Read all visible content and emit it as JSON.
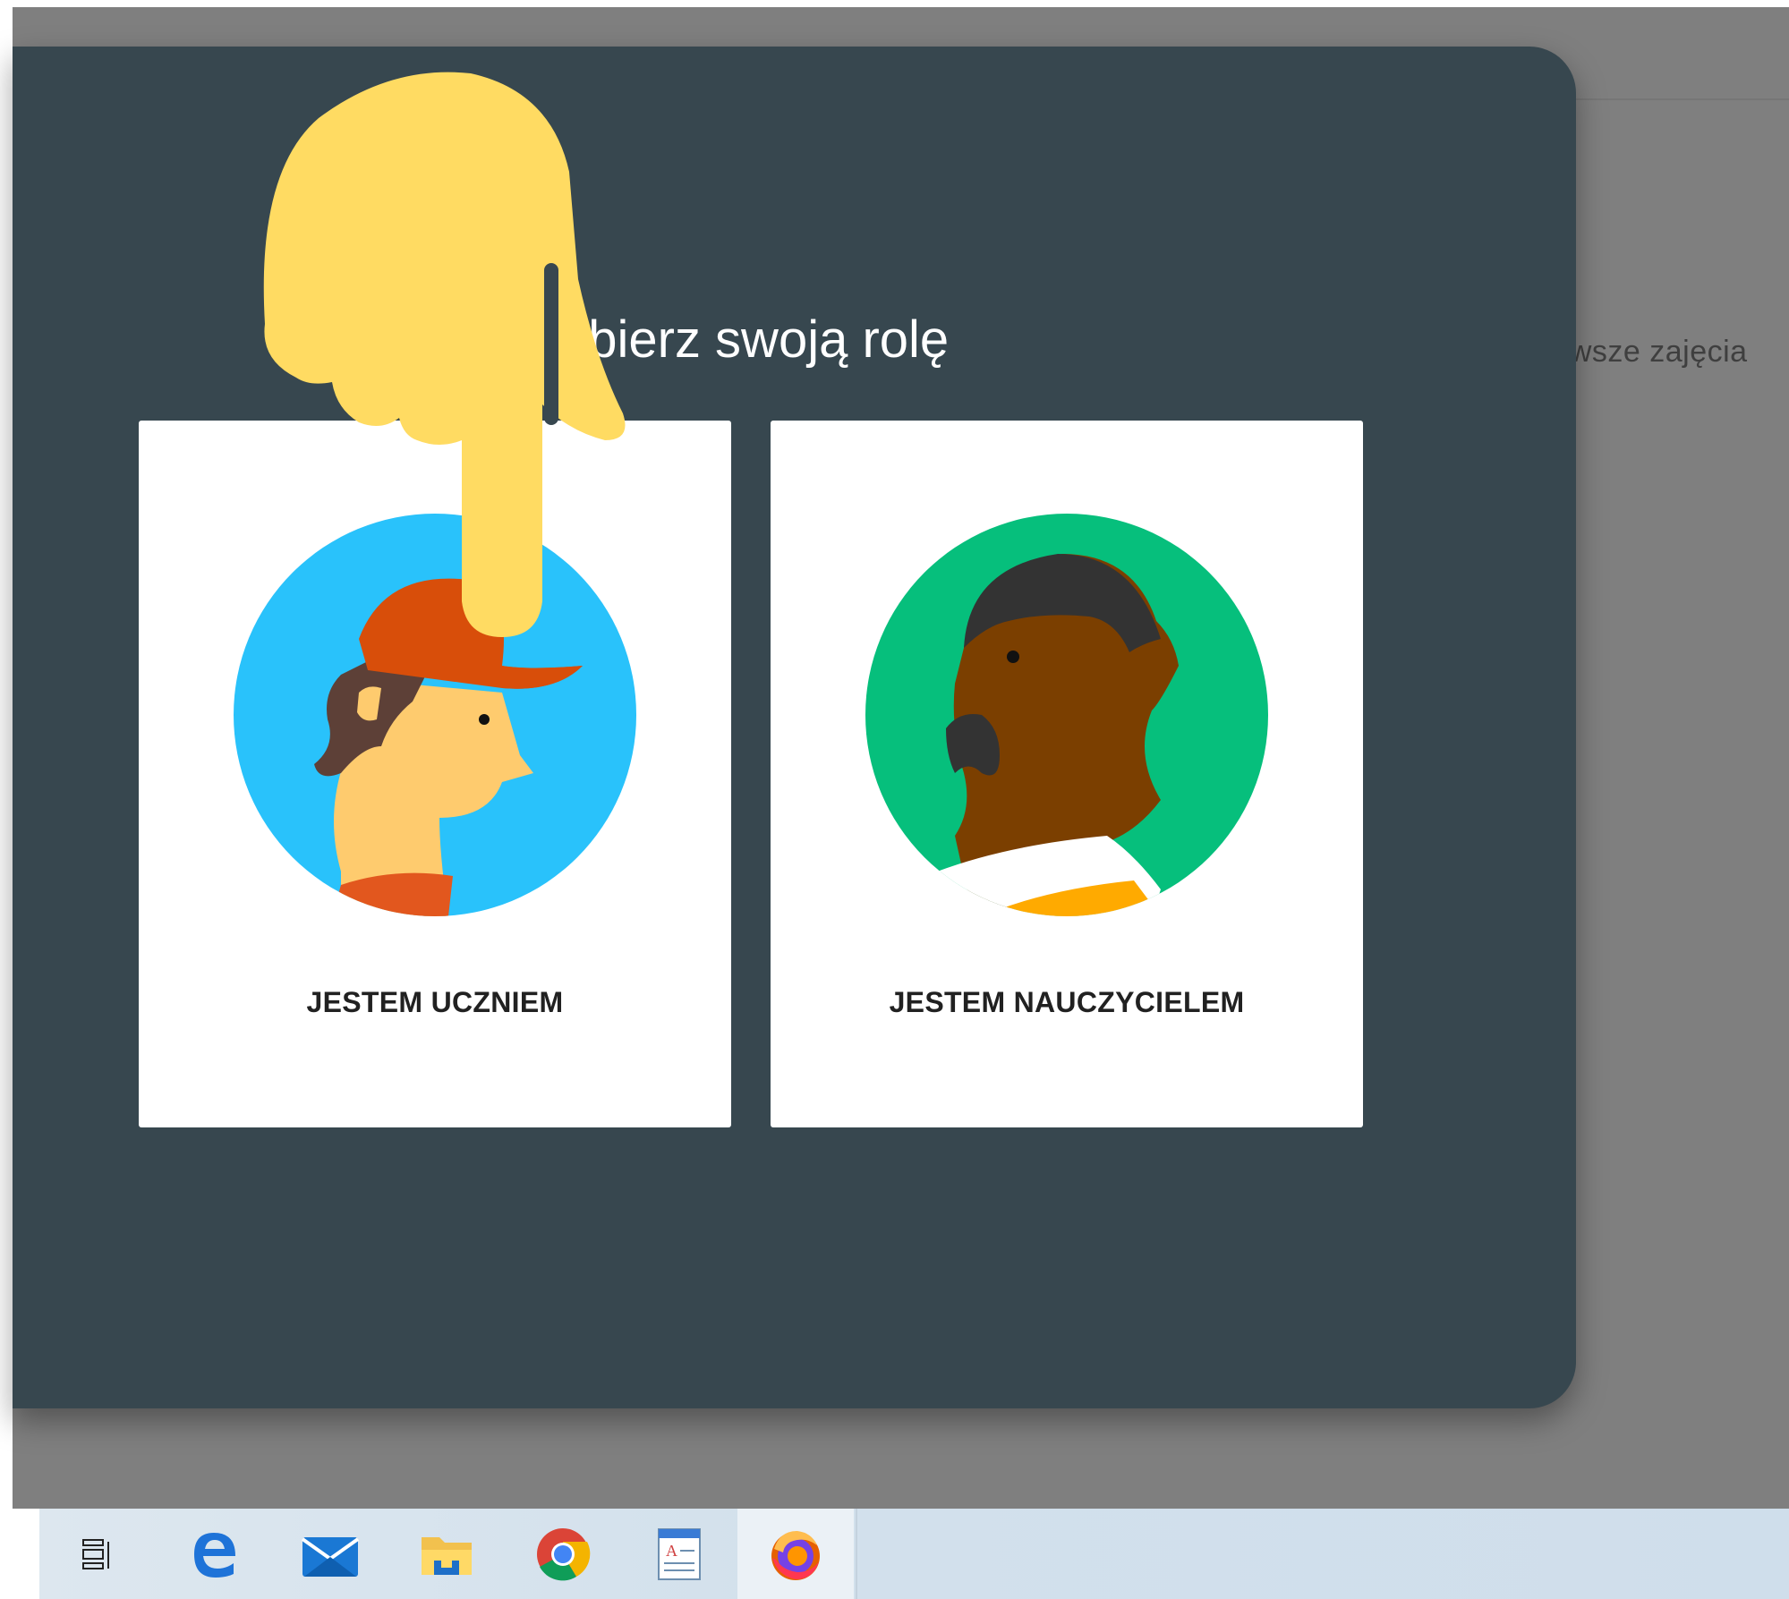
{
  "page": {
    "background_text": "rwsze zajęcia"
  },
  "dialog": {
    "title": "Wybierz swoją rolę",
    "options": [
      {
        "label": "JESTEM UCZNIEM",
        "avatar": "student-avatar",
        "circle_color": "#29c2fb"
      },
      {
        "label": "JESTEM NAUCZYCIELEM",
        "avatar": "teacher-avatar",
        "circle_color": "#06bf7c"
      }
    ]
  },
  "overlay": {
    "icon": "pointing-hand-icon",
    "color": "#ffdb62"
  },
  "taskbar": {
    "items": [
      {
        "name": "task-view-icon"
      },
      {
        "name": "edge-icon"
      },
      {
        "name": "mail-icon"
      },
      {
        "name": "file-explorer-icon"
      },
      {
        "name": "chrome-icon"
      },
      {
        "name": "wordpad-icon"
      },
      {
        "name": "firefox-icon",
        "active": true
      }
    ]
  },
  "colors": {
    "dialog_bg": "#37474f",
    "backdrop": "#7f7f7f",
    "card_bg": "#ffffff"
  }
}
